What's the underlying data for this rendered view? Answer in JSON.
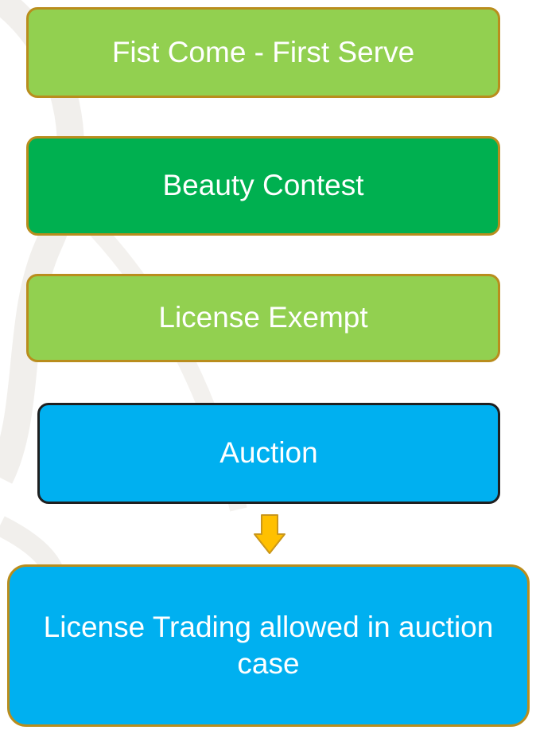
{
  "diagram": {
    "boxes": [
      {
        "label": "Fist Come - First Serve",
        "color": "#92d050"
      },
      {
        "label": "Beauty Contest",
        "color": "#00b050"
      },
      {
        "label": "License Exempt",
        "color": "#92d050"
      },
      {
        "label": "Auction",
        "color": "#00b0f0"
      }
    ],
    "arrow": {
      "icon": "down-arrow-icon",
      "color": "#ffc000"
    },
    "result": {
      "label": "License Trading allowed in auction case",
      "color": "#00b0f0"
    }
  }
}
